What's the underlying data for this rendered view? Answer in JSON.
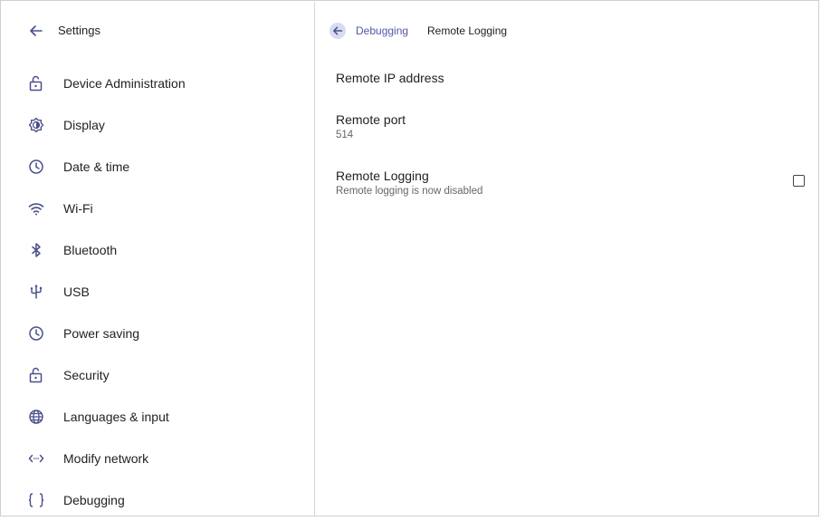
{
  "sidebar": {
    "title": "Settings",
    "items": [
      {
        "label": "Device Administration",
        "icon": "unlock-icon"
      },
      {
        "label": "Display",
        "icon": "brightness-icon"
      },
      {
        "label": "Date & time",
        "icon": "clock-icon"
      },
      {
        "label": "Wi-Fi",
        "icon": "wifi-icon"
      },
      {
        "label": "Bluetooth",
        "icon": "bluetooth-icon"
      },
      {
        "label": "USB",
        "icon": "usb-icon"
      },
      {
        "label": "Power saving",
        "icon": "clock-icon"
      },
      {
        "label": "Security",
        "icon": "unlock-icon"
      },
      {
        "label": "Languages & input",
        "icon": "globe-icon"
      },
      {
        "label": "Modify network",
        "icon": "code-arrows-icon"
      },
      {
        "label": "Debugging",
        "icon": "braces-icon"
      }
    ]
  },
  "breadcrumb": {
    "parent": "Debugging",
    "current": "Remote Logging"
  },
  "preferences": {
    "remote_ip": {
      "title": "Remote IP address"
    },
    "remote_port": {
      "title": "Remote port",
      "summary": "514"
    },
    "remote_logging": {
      "title": "Remote Logging",
      "summary": "Remote logging is now disabled",
      "checked": false
    }
  },
  "colors": {
    "accent": "#5357a8",
    "icon": "#4a4f8c",
    "breadcrumb_back_bg": "#d9dbf2"
  }
}
